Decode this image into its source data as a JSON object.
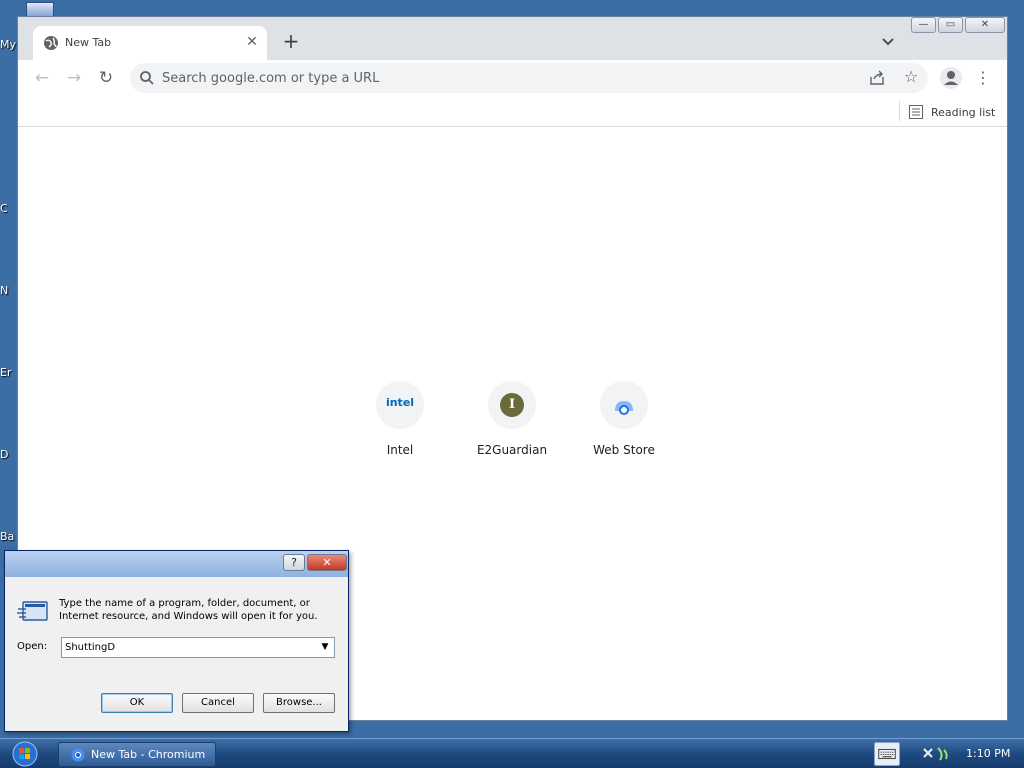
{
  "desktop": {
    "icon_labels": [
      "My",
      "C",
      "N",
      "Er",
      "D",
      "Ba"
    ]
  },
  "browser": {
    "tab": {
      "title": "New Tab",
      "close_glyph": "✕"
    },
    "new_tab_glyph": "+",
    "window_controls": {
      "minimize": "—",
      "maximize": "▭",
      "close": "✕"
    },
    "toolbar": {
      "back_glyph": "←",
      "forward_glyph": "→",
      "reload_glyph": "↻",
      "star_glyph": "☆",
      "menu_glyph": "⋮"
    },
    "omnibox": {
      "placeholder": "Search google.com or type a URL",
      "value": ""
    },
    "bookmarks_bar": {
      "reading_list_label": "Reading list"
    },
    "shortcuts": [
      {
        "label": "Intel",
        "icon_text": "intel"
      },
      {
        "label": "E2Guardian",
        "icon_text": "I"
      },
      {
        "label": "Web Store",
        "icon_text": ""
      }
    ]
  },
  "run_dialog": {
    "help_glyph": "?",
    "close_glyph": "✕",
    "description": "Type the name of a program, folder, document, or Internet resource, and Windows will open it for you.",
    "open_label": "Open:",
    "open_value": "ShuttingD",
    "ok_label": "OK",
    "cancel_label": "Cancel",
    "browse_label": "Browse..."
  },
  "taskbar": {
    "task_label": "New Tab - Chromium",
    "clock": "1:10 PM"
  },
  "colors": {
    "desktop": "#3a6ea5",
    "tab_strip": "#dee1e6",
    "omnibox": "#f1f3f4",
    "taskbar": "#1f4a80",
    "intel_blue": "#0068b5",
    "e2guardian_badge": "#6b6a3a"
  }
}
